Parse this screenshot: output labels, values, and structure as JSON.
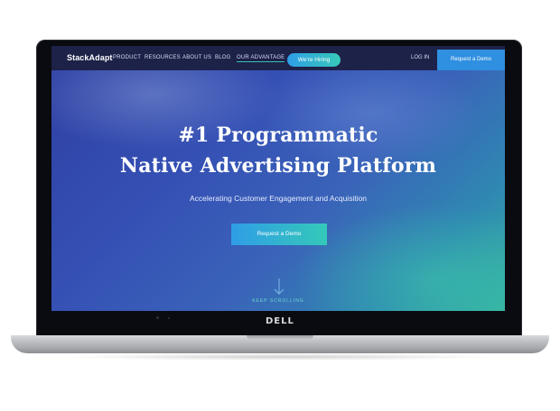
{
  "navbar": {
    "logo": "StackAdapt",
    "links": [
      "PRODUCT",
      "RESOURCES",
      "ABOUT US",
      "BLOG",
      "OUR ADVANTAGE"
    ],
    "hiring_label": "We're Hiring",
    "login_label": "LOG IN",
    "demo_label": "Request a Demo"
  },
  "hero": {
    "title_line1": "#1 Programmatic",
    "title_line2": "Native Advertising Platform",
    "subtitle": "Accelerating Customer Engagement and Acquisition",
    "cta_label": "Request a Demo",
    "scroll_label": "KEEP SCROLLING"
  },
  "device": {
    "brand": "DELL"
  },
  "colors": {
    "nav_bg": "#1d2249",
    "accent_teal": "#35c9b9",
    "accent_blue": "#2f9de6"
  },
  "icons": {
    "scroll": "arrow-down-icon"
  }
}
